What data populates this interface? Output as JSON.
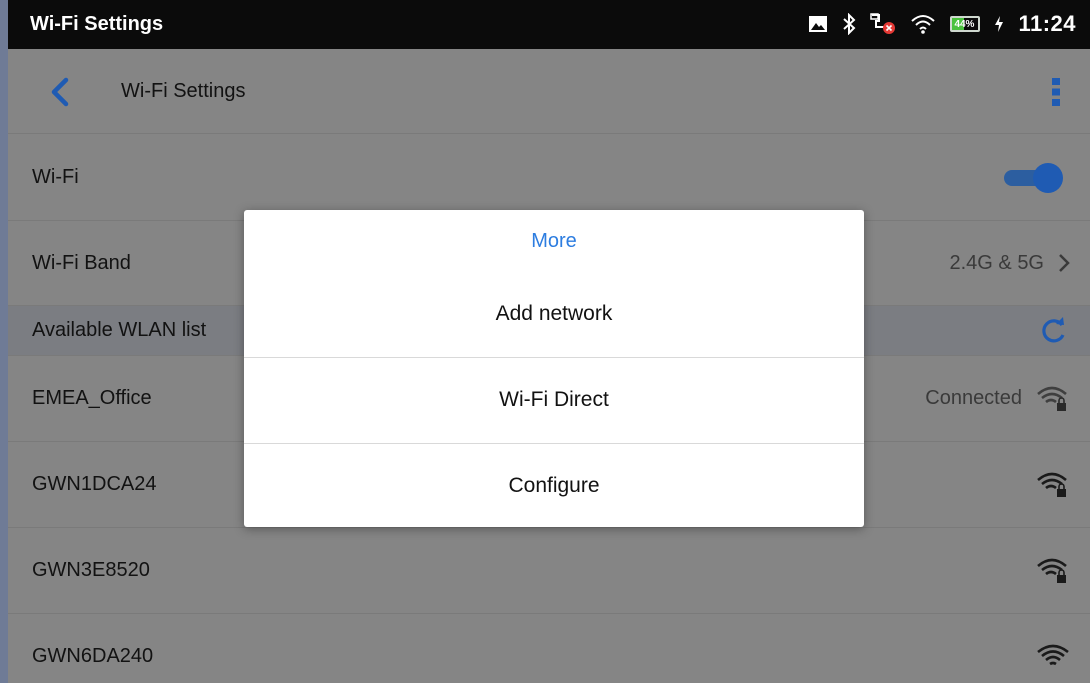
{
  "status_bar": {
    "title": "Wi-Fi Settings",
    "battery_percent": "44%",
    "battery_level": 0.44,
    "time": "11:24",
    "icons": [
      "image-icon",
      "bluetooth-icon",
      "ethernet-error-icon",
      "wifi-icon",
      "battery-icon",
      "charging-icon"
    ]
  },
  "toolbar": {
    "title": "Wi-Fi Settings",
    "back_icon": "chevron-left-icon",
    "menu_icon": "more-vertical-icon"
  },
  "settings": {
    "wifi_label": "Wi-Fi",
    "wifi_enabled": true,
    "band_label": "Wi-Fi Band",
    "band_value": "2.4G & 5G",
    "list_header": "Available WLAN list"
  },
  "networks": [
    {
      "ssid": "EMEA_Office",
      "status": "Connected",
      "secured": true
    },
    {
      "ssid": "GWN1DCA24",
      "status": "",
      "secured": true
    },
    {
      "ssid": "GWN3E8520",
      "status": "",
      "secured": true
    },
    {
      "ssid": "GWN6DA240",
      "status": "",
      "secured": false
    }
  ],
  "dialog": {
    "title": "More",
    "items": [
      "Add network",
      "Wi-Fi Direct",
      "Configure"
    ]
  },
  "colors": {
    "accent": "#2d7de0",
    "toggle_on": "#1f5bb3",
    "scrim_background": "#858585",
    "battery_green": "#4ac23d"
  }
}
